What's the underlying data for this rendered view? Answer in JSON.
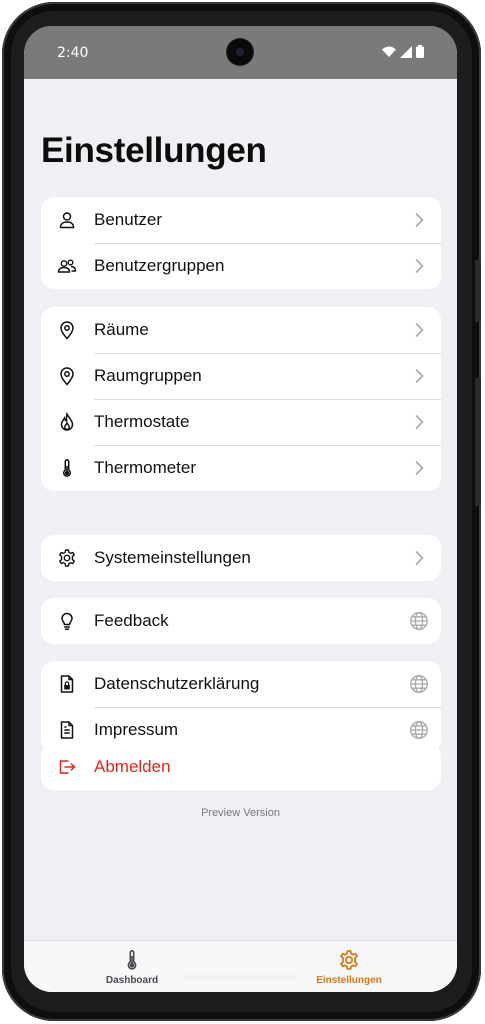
{
  "status_bar": {
    "time": "2:40",
    "icons": [
      "wifi-icon",
      "signal-icon",
      "battery-icon"
    ]
  },
  "page": {
    "title": "Einstellungen"
  },
  "groups": [
    {
      "items": [
        {
          "label": "Benutzer",
          "icon": "user-icon",
          "trailing": "chevron-right-icon"
        },
        {
          "label": "Benutzergruppen",
          "icon": "users-icon",
          "trailing": "chevron-right-icon"
        }
      ]
    },
    {
      "items": [
        {
          "label": "Räume",
          "icon": "map-pin-icon",
          "trailing": "chevron-right-icon"
        },
        {
          "label": "Raumgruppen",
          "icon": "map-pin-icon",
          "trailing": "chevron-right-icon"
        },
        {
          "label": "Thermostate",
          "icon": "flame-icon",
          "trailing": "chevron-right-icon"
        },
        {
          "label": "Thermometer",
          "icon": "thermometer-icon",
          "trailing": "chevron-right-icon"
        }
      ]
    },
    {
      "items": [
        {
          "label": "Systemeinstellungen",
          "icon": "gear-icon",
          "trailing": "chevron-right-icon"
        }
      ]
    },
    {
      "items": [
        {
          "label": "Feedback",
          "icon": "lightbulb-icon",
          "trailing": "globe-icon"
        }
      ]
    },
    {
      "items": [
        {
          "label": "Datenschutzerklärung",
          "icon": "file-lock-icon",
          "trailing": "globe-icon"
        },
        {
          "label": "Impressum",
          "icon": "file-text-icon",
          "trailing": "globe-icon"
        }
      ]
    },
    {
      "items": [
        {
          "label": "Abmelden",
          "icon": "logout-icon",
          "trailing": ""
        }
      ]
    }
  ],
  "footer": {
    "preview_label": "Preview Version"
  },
  "tabbar": {
    "tabs": [
      {
        "label": "Dashboard",
        "icon": "thermometer-icon",
        "active": false
      },
      {
        "label": "Einstellungen",
        "icon": "gear-icon",
        "active": true
      }
    ]
  },
  "colors": {
    "accent": "#d97a14",
    "danger": "#e0261d",
    "background": "#f0f0f4",
    "tab_inactive": "#4a4a4e"
  }
}
